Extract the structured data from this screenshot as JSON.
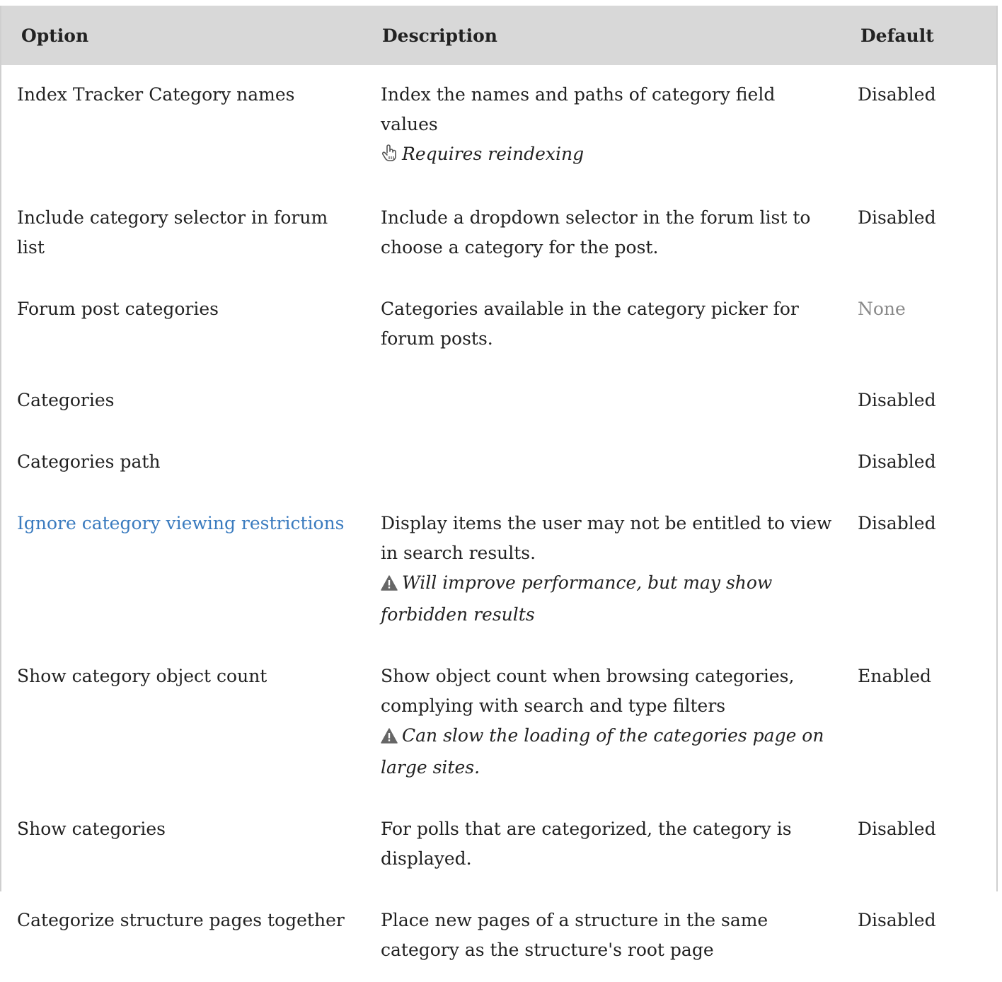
{
  "table": {
    "headers": {
      "option": "Option",
      "description": "Description",
      "default": "Default"
    },
    "rows": [
      {
        "option": "Index Tracker Category names",
        "description": "Index the names and paths of category field values",
        "note": "Requires reindexing",
        "note_icon": "hand-pointer-icon",
        "default": "Disabled"
      },
      {
        "option": "Include category selector in forum list",
        "description": "Include a dropdown selector in the forum list to choose a category for the post.",
        "default": "Disabled"
      },
      {
        "option": "Forum post categories",
        "description": "Categories available in the category picker for forum posts.",
        "default": "None"
      },
      {
        "option": "Categories",
        "description": "",
        "default": "Disabled"
      },
      {
        "option": "Categories path",
        "description": "",
        "default": "Disabled"
      },
      {
        "option": "Ignore category viewing restrictions",
        "description": "Display items the user may not be entitled to view in search results.",
        "note": "Will improve performance, but may show forbidden results",
        "note_icon": "warning-icon",
        "default": "Disabled"
      },
      {
        "option": "Show category object count",
        "description": "Show object count when browsing categories, complying with search and type filters",
        "note": "Can slow the loading of the categories page on large sites.",
        "note_icon": "warning-icon",
        "default": "Enabled"
      },
      {
        "option": "Show categories",
        "description": "For polls that are categorized, the category is displayed.",
        "default": "Disabled"
      },
      {
        "option": "Categorize structure pages together",
        "description": "Place new pages of a structure in the same category as the structure's root page",
        "default": "Disabled"
      }
    ]
  },
  "colors": {
    "header_bg": "#d8d8d8",
    "link": "#3a7bbf",
    "muted": "#8a8a8a",
    "text": "#222222"
  }
}
